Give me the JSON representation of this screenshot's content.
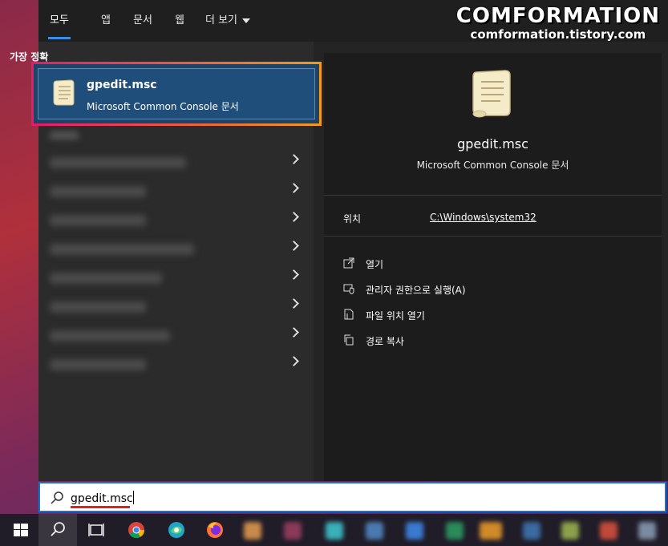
{
  "tabs": [
    {
      "label": "모두",
      "active": true
    },
    {
      "label": "앱",
      "active": false
    },
    {
      "label": "문서",
      "active": false
    },
    {
      "label": "웹",
      "active": false
    },
    {
      "label": "더 보기",
      "active": false
    }
  ],
  "watermark": {
    "line1": "COMFORMATION",
    "line2": "comformation.tistory.com"
  },
  "best_match": {
    "section_label": "가장 정확",
    "title": "gpedit.msc",
    "subtitle": "Microsoft Common Console 문서",
    "icon": "scroll-document-icon"
  },
  "other_results": {
    "count_rows": 8
  },
  "detail": {
    "title": "gpedit.msc",
    "subtitle": "Microsoft Common Console 문서",
    "location_label": "위치",
    "location_value": "C:\\Windows\\system32",
    "actions": [
      {
        "label": "열기",
        "icon": "open-icon"
      },
      {
        "label": "관리자 권한으로 실행(A)",
        "icon": "admin-shield-icon"
      },
      {
        "label": "파일 위치 열기",
        "icon": "file-location-icon"
      },
      {
        "label": "경로 복사",
        "icon": "copy-path-icon"
      }
    ]
  },
  "search": {
    "value": "gpedit.msc"
  },
  "taskbar": {
    "items": [
      "windows-start-icon",
      "search-icon",
      "task-view-icon",
      "chrome-icon",
      "edge-chromium-icon",
      "firefox-icon"
    ]
  },
  "colors": {
    "accent": "#3a8ee6",
    "best_match_bg": "#1f4e7a",
    "highlight_border_start": "#e8186c",
    "highlight_border_end": "#f29a1a"
  }
}
